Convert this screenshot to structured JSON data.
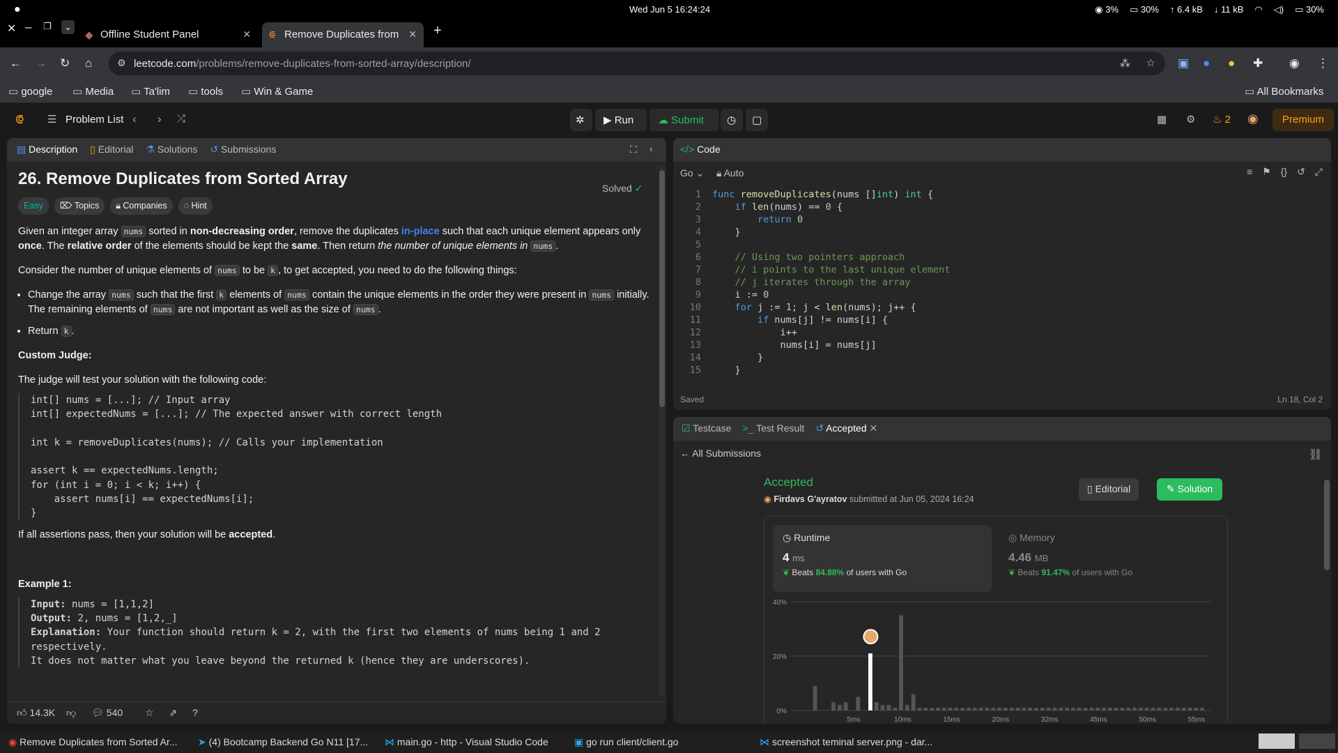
{
  "os": {
    "clock": "Wed Jun 5  16:24:24",
    "cpu": "3%",
    "mem": "30%",
    "up": "6.4 kB",
    "down": "11 kB",
    "battery": "30%"
  },
  "browser": {
    "tabs": [
      {
        "label": "Offline Student Panel"
      },
      {
        "label": "Remove Duplicates from"
      }
    ],
    "url_host": "leetcode.com",
    "url_path": "/problems/remove-duplicates-from-sorted-array/description/",
    "bookmarks": [
      "google",
      "Media",
      "Ta'lim",
      "tools",
      "Win & Game"
    ],
    "all_bookmarks": "All Bookmarks"
  },
  "header": {
    "problem_list": "Problem List",
    "run": "Run",
    "submit": "Submit",
    "streak": "2",
    "premium": "Premium"
  },
  "left": {
    "tabs": [
      "Description",
      "Editorial",
      "Solutions",
      "Submissions"
    ],
    "title": "26. Remove Duplicates from Sorted Array",
    "solved": "Solved",
    "tags": [
      "Easy",
      "Topics",
      "Companies",
      "Hint"
    ],
    "p1a": "Given an integer array ",
    "nums": "nums",
    "p1b": " sorted in ",
    "p1c": "non-decreasing order",
    "p1d": ", remove the duplicates ",
    "inplace": "in-place",
    "p1e": " such that each unique element appears only ",
    "once": "once",
    "p1f": ". The ",
    "rel": "relative order",
    "p1g": " of the elements should be kept the ",
    "same": "same",
    "p1h": ". Then return ",
    "p1i": "the number of unique elements in",
    "p2a": "Consider the number of unique elements of ",
    "p2b": " to be ",
    "k": "k",
    "p2c": ", to get accepted, you need to do the following things:",
    "b1a": "Change the array ",
    "b1b": " such that the first ",
    "b1c": " elements of ",
    "b1d": " contain the unique elements in the order they were present in ",
    "b1e": " initially. The remaining elements of ",
    "b1f": " are not important as well as the size of ",
    "b2": "Return ",
    "judge_h": "Custom Judge:",
    "judge_p": "The judge will test your solution with the following code:",
    "judge_code": "int[] nums = [...]; // Input array\nint[] expectedNums = [...]; // The expected answer with correct length\n\nint k = removeDuplicates(nums); // Calls your implementation\n\nassert k == expectedNums.length;\nfor (int i = 0; i < k; i++) {\n    assert nums[i] == expectedNums[i];\n}",
    "assert_a": "If all assertions pass, then your solution will be ",
    "accepted": "accepted",
    "ex1": "Example 1:",
    "ex_input": "Input:",
    "ex_input_v": " nums = [1,1,2]",
    "ex_output": "Output:",
    "ex_output_v": " 2, nums = [1,2,_]",
    "ex_expl": "Explanation:",
    "ex_expl_v": " Your function should return k = 2, with the first two elements of nums being 1 and 2\nrespectively.",
    "ex_more": "It does not matter what you leave beyond the returned k (hence they are underscores).",
    "likes": "14.3K",
    "comments": "540"
  },
  "editor": {
    "title": "Code",
    "lang": "Go",
    "mode": "Auto",
    "saved": "Saved",
    "cursor": "Ln 18, Col 2",
    "lines": [
      "func removeDuplicates(nums []int) int {",
      "    if len(nums) == 0 {",
      "        return 0",
      "    }",
      "",
      "    // Using two pointers approach",
      "    // i points to the last unique element",
      "    // j iterates through the array",
      "    i := 0",
      "    for j := 1; j < len(nums); j++ {",
      "        if nums[j] != nums[i] {",
      "            i++",
      "            nums[i] = nums[j]",
      "        }",
      "    }"
    ]
  },
  "result": {
    "tabs": [
      "Testcase",
      "Test Result",
      "Accepted"
    ],
    "all_submissions": "All Submissions",
    "status": "Accepted",
    "user": "Firdavs G'ayratov",
    "submitted": "submitted at Jun 05, 2024 16:24",
    "editorial": "Editorial",
    "solution": "Solution",
    "runtime_label": "Runtime",
    "runtime_value": "4",
    "runtime_unit": "ms",
    "runtime_beats_a": "Beats ",
    "runtime_beats": "84.88%",
    "runtime_beats_b": " of users with Go",
    "memory_label": "Memory",
    "memory_value": "4.46",
    "memory_unit": "MB",
    "memory_beats_a": "Beats ",
    "memory_beats": "91.47%",
    "memory_beats_b": " of users with Go"
  },
  "chart_data": {
    "type": "bar",
    "ylabels": [
      "40%",
      "20%",
      "0%"
    ],
    "xlabels": [
      "5ms",
      "10ms",
      "15ms",
      "20ms",
      "32ms",
      "45ms",
      "50ms",
      "55ms"
    ],
    "values": [
      0,
      0,
      9,
      0,
      0,
      3,
      2,
      3,
      0,
      5,
      0,
      21,
      3,
      2,
      2,
      1,
      35,
      2,
      6,
      1,
      1,
      1,
      1,
      1,
      1,
      1,
      1,
      1,
      1,
      1,
      1,
      1,
      1,
      1,
      1,
      1,
      1,
      1,
      1,
      1,
      1,
      1,
      1,
      1,
      1,
      1,
      1,
      1,
      1,
      1,
      1,
      1,
      1,
      1,
      1,
      1,
      1,
      1,
      1,
      1,
      1,
      1,
      1,
      1,
      1,
      1
    ],
    "highlight_index": 11,
    "ymax": 40
  },
  "dock": [
    "Remove Duplicates from Sorted Ar...",
    "(4) Bootcamp Backend Go N11 [17...",
    "main.go - http - Visual Studio Code",
    "go run client/client.go",
    "screenshot teminal server.png - dar..."
  ],
  "colors": {
    "accent": "#ffa116",
    "green": "#2cbb5d",
    "easy": "#00b8a3",
    "link": "#3b82f6"
  }
}
